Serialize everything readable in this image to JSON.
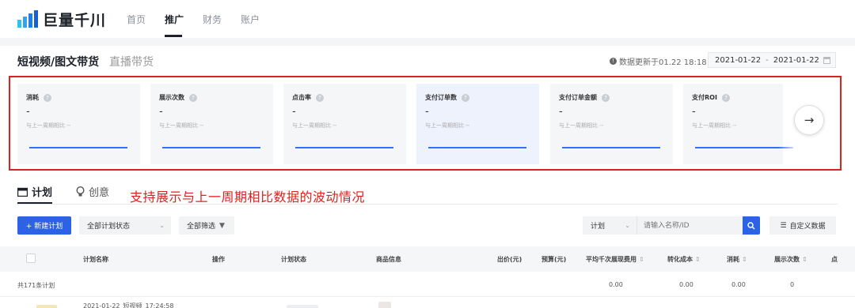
{
  "brand": {
    "name": "巨量千川"
  },
  "nav": [
    "首页",
    "推广",
    "财务",
    "账户"
  ],
  "subheader": {
    "tab_active": "短视频/图文带货",
    "tab_other": "直播带货",
    "update_text": "数据更新于01.22 18:18",
    "date_start": "2021-01-22",
    "date_sep": "-",
    "date_end": "2021-01-22"
  },
  "metrics": [
    {
      "title": "消耗",
      "value": "-",
      "compare": "与上一周期相比 --"
    },
    {
      "title": "展示次数",
      "value": "-",
      "compare": "与上一周期相比 --"
    },
    {
      "title": "点击率",
      "value": "-",
      "compare": "与上一周期相比 --"
    },
    {
      "title": "支付订单数",
      "value": "-",
      "compare": "与上一周期相比 --"
    },
    {
      "title": "支付订单金额",
      "value": "-",
      "compare": "与上一周期相比 --"
    },
    {
      "title": "支付ROI",
      "value": "-",
      "compare": "与上一周期相比 --"
    }
  ],
  "section_tabs": {
    "plan": "计划",
    "creative": "创意"
  },
  "annotation": "支持展示与上一周期相比数据的波动情况",
  "toolbar": {
    "new_plan": "+ 新建计划",
    "status_filter": "全部计划状态",
    "all_filter": "全部筛选",
    "search_type": "计划",
    "search_placeholder": "请输入名称/ID",
    "custom_data": "自定义数据"
  },
  "table": {
    "headers": {
      "name": "计划名称",
      "op": "操作",
      "status": "计划状态",
      "product": "商品信息",
      "bid": "出价(元)",
      "budget": "预算(元)",
      "cpm": "平均千次展现费用",
      "cost_conv": "转化成本",
      "spend": "消耗",
      "impressions": "展示次数",
      "clicks": "点"
    },
    "summary": {
      "label": "共171条计划",
      "cpm": "0.00",
      "cost_conv": "0.00",
      "spend": "0.00",
      "impressions": "0"
    },
    "row1_name": "2021-01-22_短视频_17:24:58"
  },
  "colors": {
    "accent": "#2c62e6",
    "annotation": "#d9231f"
  }
}
